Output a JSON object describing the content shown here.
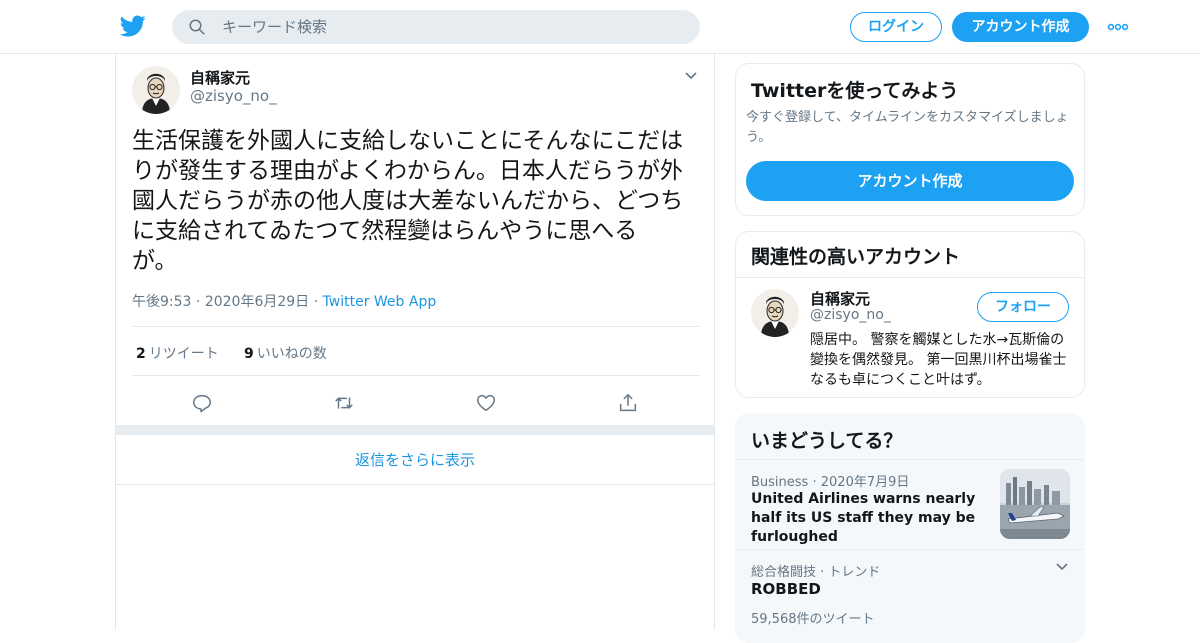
{
  "header": {
    "search_placeholder": "キーワード検索",
    "login_label": "ログイン",
    "signup_label": "アカウント作成",
    "brand_color": "#1da1f2"
  },
  "tweet": {
    "author_name": "自稱家元",
    "author_handle": "@zisyo_no_",
    "text": "生活保護を外國人に支給しないことにそんなにこだは\nりが發生する理由がよくわからん。日本人だらうが外\n國人だらうが赤の他人度は大差ないんだから、どつち\nに支給されてゐたつて然程變はらんやうに思へる\nが。",
    "time": "午後9:53",
    "date": "2020年6月29日",
    "source": "Twitter Web App",
    "separator": "·",
    "retweet_count": "2",
    "retweet_label": "リツイート",
    "like_count": "9",
    "like_label": "いいねの数",
    "more_replies_label": "返信をさらに表示"
  },
  "sidebar": {
    "signup_card": {
      "title": "Twitterを使ってみよう",
      "description": "今すぐ登録して、タイムラインをカスタマイズしましょう。",
      "button_label": "アカウント作成"
    },
    "related": {
      "title": "関連性の高いアカウント",
      "name": "自稱家元",
      "handle": "@zisyo_no_",
      "follow_label": "フォロー",
      "bio": "隠居中。 警察を觸媒とした水→瓦斯倫の變換を偶然發見。 第一回黒川杯出場雀士なるも卓につくこと叶はず。"
    },
    "trends": {
      "title": "いまどうしてる？",
      "items": [
        {
          "category": "Business",
          "date": "2020年7月9日",
          "headline": "United Airlines warns nearly half its US staff they may be furloughed"
        },
        {
          "category": "総合格闘技 · トレンド",
          "headline": "ROBBED",
          "count": "59,568件のツイート"
        }
      ]
    }
  }
}
